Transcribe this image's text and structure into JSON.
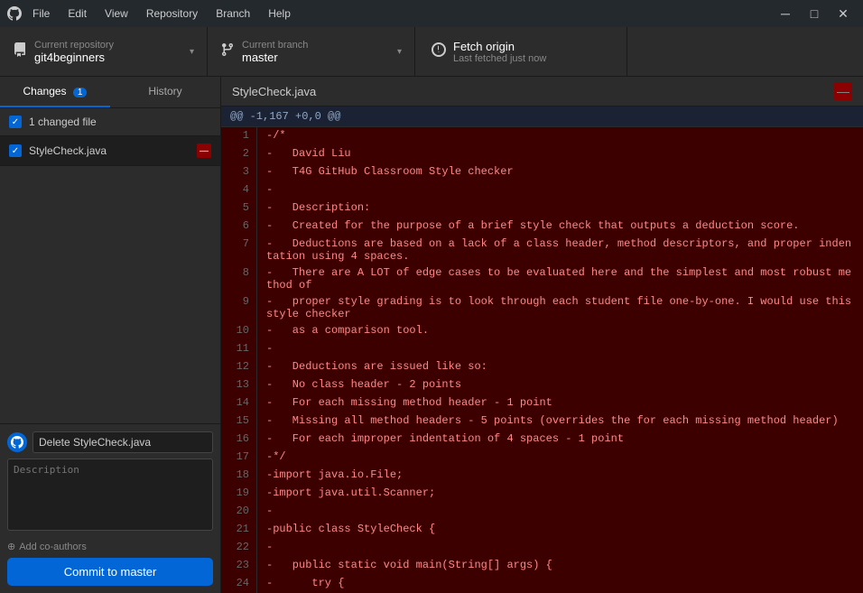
{
  "titlebar": {
    "logo_label": "GitHub Desktop",
    "menu_items": [
      "File",
      "Edit",
      "View",
      "Repository",
      "Branch",
      "Help"
    ],
    "controls": {
      "minimize": "─",
      "maximize": "□",
      "close": "✕"
    }
  },
  "toolbar": {
    "repo_label": "Current repository",
    "repo_name": "git4beginners",
    "branch_label": "Current branch",
    "branch_name": "master",
    "fetch_label": "Fetch origin",
    "fetch_sublabel": "Last fetched just now"
  },
  "left_panel": {
    "tab_changes": "Changes",
    "tab_changes_badge": "1",
    "tab_history": "History",
    "changed_count": "1 changed file",
    "file_name": "StyleCheck.java",
    "commit_title": "Delete StyleCheck.java",
    "commit_description_placeholder": "Description",
    "add_coauthor_label": "Add co-authors",
    "commit_button_label": "Commit to master"
  },
  "diff": {
    "filename": "StyleCheck.java",
    "hunk_header": "@@ -1,167 +0,0 @@",
    "lines": [
      {
        "num": 1,
        "type": "removed",
        "content": "-/*"
      },
      {
        "num": 2,
        "type": "removed",
        "content": "-   David Liu"
      },
      {
        "num": 3,
        "type": "removed",
        "content": "-   T4G GitHub Classroom Style checker"
      },
      {
        "num": 4,
        "type": "removed",
        "content": "-"
      },
      {
        "num": 5,
        "type": "removed",
        "content": "-   Description:"
      },
      {
        "num": 6,
        "type": "removed",
        "content": "-   Created for the purpose of a brief style check that outputs a deduction score."
      },
      {
        "num": 7,
        "type": "removed",
        "content": "-   Deductions are based on a lack of a class header, method descriptors, and proper indentation using 4 spaces."
      },
      {
        "num": 8,
        "type": "removed",
        "content": "-   There are A LOT of edge cases to be evaluated here and the simplest and most robust method of"
      },
      {
        "num": 9,
        "type": "removed",
        "content": "-   proper style grading is to look through each student file one-by-one. I would use this style checker"
      },
      {
        "num": 10,
        "type": "removed",
        "content": "-   as a comparison tool."
      },
      {
        "num": 11,
        "type": "removed",
        "content": "-"
      },
      {
        "num": 12,
        "type": "removed",
        "content": "-   Deductions are issued like so:"
      },
      {
        "num": 13,
        "type": "removed",
        "content": "-   No class header - 2 points"
      },
      {
        "num": 14,
        "type": "removed",
        "content": "-   For each missing method header - 1 point"
      },
      {
        "num": 15,
        "type": "removed",
        "content": "-   Missing all method headers - 5 points (overrides the for each missing method header)"
      },
      {
        "num": 16,
        "type": "removed",
        "content": "-   For each improper indentation of 4 spaces - 1 point"
      },
      {
        "num": 17,
        "type": "removed",
        "content": "-*/"
      },
      {
        "num": 18,
        "type": "removed",
        "content": "-import java.io.File;"
      },
      {
        "num": 19,
        "type": "removed",
        "content": "-import java.util.Scanner;"
      },
      {
        "num": 20,
        "type": "removed",
        "content": "-"
      },
      {
        "num": 21,
        "type": "removed",
        "content": "-public class StyleCheck {"
      },
      {
        "num": 22,
        "type": "removed",
        "content": "-"
      },
      {
        "num": 23,
        "type": "removed",
        "content": "-   public static void main(String[] args) {"
      },
      {
        "num": 24,
        "type": "removed",
        "content": "-      try {"
      }
    ]
  }
}
